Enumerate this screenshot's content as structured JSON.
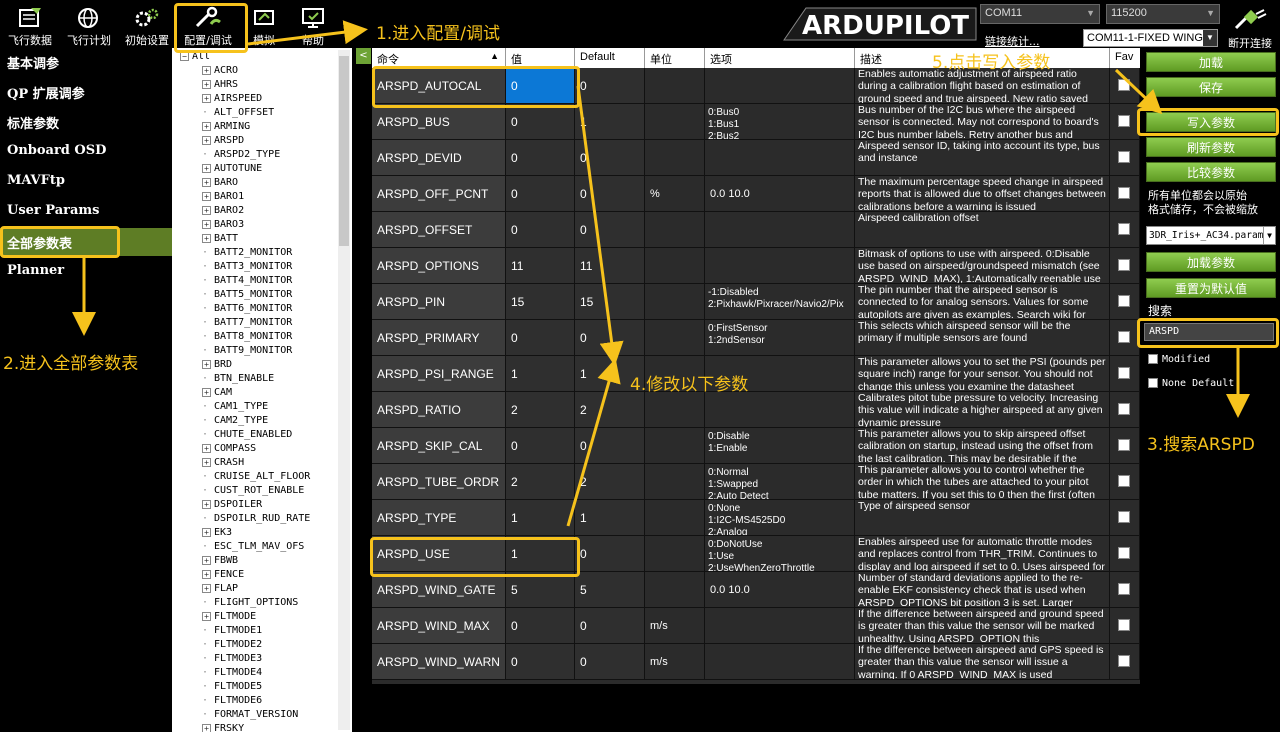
{
  "toolbar": {
    "buttons": [
      {
        "label": "飞行数据",
        "icon": "flight-data-icon"
      },
      {
        "label": "飞行计划",
        "icon": "flight-plan-globe-icon"
      },
      {
        "label": "初始设置",
        "icon": "initial-setup-gears-icon"
      },
      {
        "label": "配置/调试",
        "icon": "config-tuning-wrench-icon"
      },
      {
        "label": "模拟",
        "icon": "simulation-icon"
      },
      {
        "label": "帮助",
        "icon": "help-monitor-icon"
      }
    ],
    "logo_text": "ARDUPILOT",
    "com_port": "COM11",
    "baud_rate": "115200",
    "link_stats": "链接统计...",
    "connection_mode": "COM11-1-FIXED WING",
    "disconnect_label": "断开连接"
  },
  "left_menu": {
    "items": [
      {
        "label": "基本调参",
        "active": false
      },
      {
        "label": "QP 扩展调参",
        "active": false
      },
      {
        "label": "标准参数",
        "active": false
      },
      {
        "label": "Onboard OSD",
        "active": false
      },
      {
        "label": "MAVFtp",
        "active": false
      },
      {
        "label": "User Params",
        "active": false
      },
      {
        "label": "全部参数表",
        "active": true
      },
      {
        "label": "Planner",
        "active": false
      }
    ]
  },
  "tree": {
    "root": "All",
    "items": [
      {
        "label": "ACRO",
        "expandable": true
      },
      {
        "label": "AHRS",
        "expandable": true
      },
      {
        "label": "AIRSPEED",
        "expandable": true
      },
      {
        "label": "ALT_OFFSET",
        "expandable": false
      },
      {
        "label": "ARMING",
        "expandable": true
      },
      {
        "label": "ARSPD",
        "expandable": true
      },
      {
        "label": "ARSPD2_TYPE",
        "expandable": false
      },
      {
        "label": "AUTOTUNE",
        "expandable": true
      },
      {
        "label": "BARO",
        "expandable": true
      },
      {
        "label": "BARO1",
        "expandable": true
      },
      {
        "label": "BARO2",
        "expandable": true
      },
      {
        "label": "BARO3",
        "expandable": true
      },
      {
        "label": "BATT",
        "expandable": true
      },
      {
        "label": "BATT2_MONITOR",
        "expandable": false
      },
      {
        "label": "BATT3_MONITOR",
        "expandable": false
      },
      {
        "label": "BATT4_MONITOR",
        "expandable": false
      },
      {
        "label": "BATT5_MONITOR",
        "expandable": false
      },
      {
        "label": "BATT6_MONITOR",
        "expandable": false
      },
      {
        "label": "BATT7_MONITOR",
        "expandable": false
      },
      {
        "label": "BATT8_MONITOR",
        "expandable": false
      },
      {
        "label": "BATT9_MONITOR",
        "expandable": false
      },
      {
        "label": "BRD",
        "expandable": true
      },
      {
        "label": "BTN_ENABLE",
        "expandable": false
      },
      {
        "label": "CAM",
        "expandable": true
      },
      {
        "label": "CAM1_TYPE",
        "expandable": false
      },
      {
        "label": "CAM2_TYPE",
        "expandable": false
      },
      {
        "label": "CHUTE_ENABLED",
        "expandable": false
      },
      {
        "label": "COMPASS",
        "expandable": true
      },
      {
        "label": "CRASH",
        "expandable": true
      },
      {
        "label": "CRUISE_ALT_FLOOR",
        "expandable": false
      },
      {
        "label": "CUST_ROT_ENABLE",
        "expandable": false
      },
      {
        "label": "DSPOILER",
        "expandable": true
      },
      {
        "label": "DSPOILR_RUD_RATE",
        "expandable": false
      },
      {
        "label": "EK3",
        "expandable": true
      },
      {
        "label": "ESC_TLM_MAV_OFS",
        "expandable": false
      },
      {
        "label": "FBWB",
        "expandable": true
      },
      {
        "label": "FENCE",
        "expandable": true
      },
      {
        "label": "FLAP",
        "expandable": true
      },
      {
        "label": "FLIGHT_OPTIONS",
        "expandable": false
      },
      {
        "label": "FLTMODE",
        "expandable": true
      },
      {
        "label": "FLTMODE1",
        "expandable": false
      },
      {
        "label": "FLTMODE2",
        "expandable": false
      },
      {
        "label": "FLTMODE3",
        "expandable": false
      },
      {
        "label": "FLTMODE4",
        "expandable": false
      },
      {
        "label": "FLTMODE5",
        "expandable": false
      },
      {
        "label": "FLTMODE6",
        "expandable": false
      },
      {
        "label": "FORMAT_VERSION",
        "expandable": false
      },
      {
        "label": "FRSKY",
        "expandable": true
      }
    ]
  },
  "table": {
    "collapse_button": "<",
    "columns": [
      "命令",
      "值",
      "Default",
      "单位",
      "选项",
      "描述",
      "Fav"
    ],
    "sort_indicator": "▲",
    "rows": [
      {
        "name": "ARSPD_AUTOCAL",
        "value": "0",
        "default": "0",
        "units": "",
        "options": "",
        "desc": "Enables automatic adjustment of airspeed ratio during a calibration flight based on estimation of ground speed and true airspeed. New ratio saved"
      },
      {
        "name": "ARSPD_BUS",
        "value": "0",
        "default": "1",
        "units": "",
        "options": "0:Bus0\n1:Bus1\n2:Bus2",
        "desc": "Bus number of the I2C bus where the airspeed sensor is connected. May not correspond to board's I2C bus number labels. Retry another bus and"
      },
      {
        "name": "ARSPD_DEVID",
        "value": "0",
        "default": "0",
        "units": "",
        "options": "",
        "desc": "Airspeed sensor ID, taking into account its type, bus and instance"
      },
      {
        "name": "ARSPD_OFF_PCNT",
        "value": "0",
        "default": "0",
        "units": "%",
        "options": "0.0 10.0",
        "desc": "The maximum percentage speed change in airspeed reports that is allowed due to offset changes between calibrations before a warning is issued"
      },
      {
        "name": "ARSPD_OFFSET",
        "value": "0",
        "default": "0",
        "units": "",
        "options": "",
        "desc": "Airspeed calibration offset"
      },
      {
        "name": "ARSPD_OPTIONS",
        "value": "11",
        "default": "11",
        "units": "",
        "options": "",
        "desc": "Bitmask of options to use with airspeed. 0:Disable use based on airspeed/groundspeed mismatch (see ARSPD_WIND_MAX), 1:Automatically reenable use"
      },
      {
        "name": "ARSPD_PIN",
        "value": "15",
        "default": "15",
        "units": "",
        "options": "-1:Disabled\n2:Pixhawk/Pixracer/Navio2/Pix",
        "desc": "The pin number that the airspeed sensor is connected to for analog sensors. Values for some autopilots are given as examples. Search wiki for"
      },
      {
        "name": "ARSPD_PRIMARY",
        "value": "0",
        "default": "0",
        "units": "",
        "options": "0:FirstSensor\n1:2ndSensor",
        "desc": "This selects which airspeed sensor will be the primary if multiple sensors are found"
      },
      {
        "name": "ARSPD_PSI_RANGE",
        "value": "1",
        "default": "1",
        "units": "",
        "options": "",
        "desc": "This parameter allows you to set the PSI (pounds per square inch) range for your sensor. You should not change this unless you examine the datasheet"
      },
      {
        "name": "ARSPD_RATIO",
        "value": "2",
        "default": "2",
        "units": "",
        "options": "",
        "desc": "Calibrates pitot tube pressure to velocity. Increasing this value will indicate a higher airspeed at any given dynamic pressure"
      },
      {
        "name": "ARSPD_SKIP_CAL",
        "value": "0",
        "default": "0",
        "units": "",
        "options": "0:Disable\n1:Enable",
        "desc": "This parameter allows you to skip airspeed offset calibration on startup, instead using the offset from the last calibration. This may be desirable if the"
      },
      {
        "name": "ARSPD_TUBE_ORDR",
        "value": "2",
        "default": "2",
        "units": "",
        "options": "0:Normal\n1:Swapped\n2:Auto Detect",
        "desc": "This parameter allows you to control whether the order in which the tubes are attached to your pitot tube matters. If you set this to 0 then the first (often"
      },
      {
        "name": "ARSPD_TYPE",
        "value": "1",
        "default": "1",
        "units": "",
        "options": "0:None\n1:I2C-MS4525D0\n2:Analog",
        "desc": "Type of airspeed sensor"
      },
      {
        "name": "ARSPD_USE",
        "value": "1",
        "default": "0",
        "units": "",
        "options": "0:DoNotUse\n1:Use\n2:UseWhenZeroThrottle",
        "desc": "Enables airspeed use for automatic throttle modes and replaces control from THR_TRIM. Continues to display and log airspeed if set to 0. Uses airspeed for"
      },
      {
        "name": "ARSPD_WIND_GATE",
        "value": "5",
        "default": "5",
        "units": "",
        "options": "0.0 10.0",
        "desc": "Number of standard deviations applied to the re-enable EKF consistency check that is used when ARSPD_OPTIONS bit position 3 is set. Larger"
      },
      {
        "name": "ARSPD_WIND_MAX",
        "value": "0",
        "default": "0",
        "units": "m/s",
        "options": "",
        "desc": "If the difference between airspeed and ground speed is greater than this value the sensor will be marked unhealthy. Using ARSPD_OPTION this"
      },
      {
        "name": "ARSPD_WIND_WARN",
        "value": "0",
        "default": "0",
        "units": "m/s",
        "options": "",
        "desc": "If the difference between airspeed and GPS speed is greater than this value the sensor will issue a warning. If 0 ARSPD_WIND_MAX is used"
      }
    ]
  },
  "right_panel": {
    "load_label": "加载",
    "save_label": "保存",
    "write_label": "写入参数",
    "refresh_label": "刷新参数",
    "compare_label": "比较参数",
    "units_note_line1": "所有单位都会以原始",
    "units_note_line2": "格式储存，不会被缩放",
    "param_file": "3DR_Iris+_AC34.param",
    "load_preset_label": "加载参数",
    "reset_default_label": "重置为默认值",
    "search_label": "搜索",
    "search_value": "ARSPD",
    "modified_label": "Modified",
    "none_default_label": "None Default"
  },
  "annotations": {
    "step1": "1.进入配置/调试",
    "step2": "2.进入全部参数表",
    "step3": "3.搜索ARSPD",
    "step4": "4.修改以下参数",
    "step5": "5.点击写入参数",
    "color": "#f6c21c"
  }
}
